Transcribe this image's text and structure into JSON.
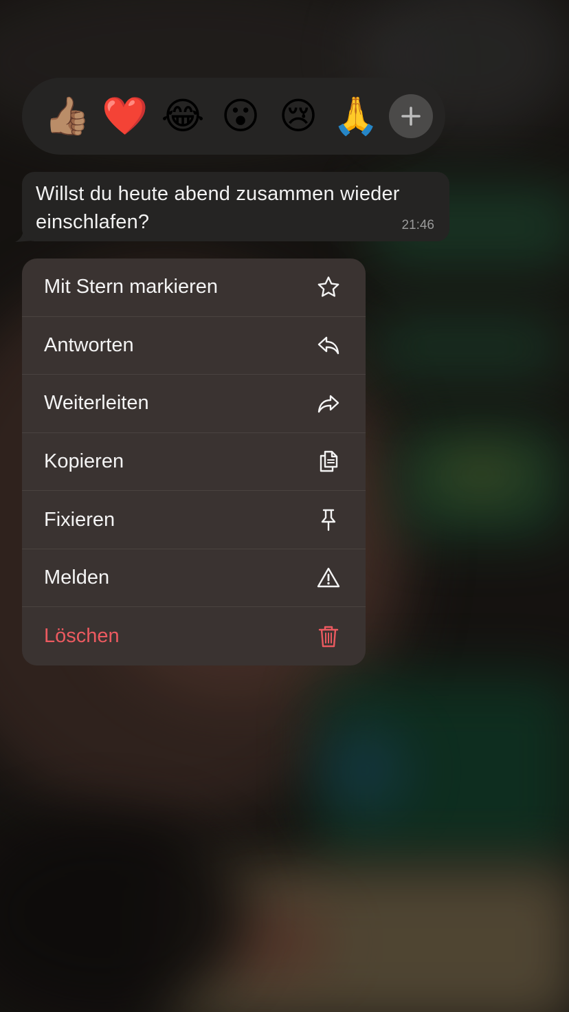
{
  "reactions": {
    "emojis": [
      "👍🏽",
      "❤️",
      "😂",
      "😮",
      "😢",
      "🙏"
    ],
    "more_icon": "plus-icon"
  },
  "message": {
    "text": "Willst du heute abend zusammen wieder einschlafen?",
    "time": "21:46"
  },
  "menu": {
    "items": [
      {
        "label": "Mit Stern markieren",
        "icon": "star-icon"
      },
      {
        "label": "Antworten",
        "icon": "reply-icon"
      },
      {
        "label": "Weiterleiten",
        "icon": "forward-icon"
      },
      {
        "label": "Kopieren",
        "icon": "copy-icon"
      },
      {
        "label": "Fixieren",
        "icon": "pin-icon"
      },
      {
        "label": "Melden",
        "icon": "warning-icon"
      },
      {
        "label": "Löschen",
        "icon": "trash-icon"
      }
    ]
  },
  "colors": {
    "panel": "#252423",
    "menu": "#3a3331",
    "danger": "#ec5a60",
    "text": "#f4f4f4"
  }
}
